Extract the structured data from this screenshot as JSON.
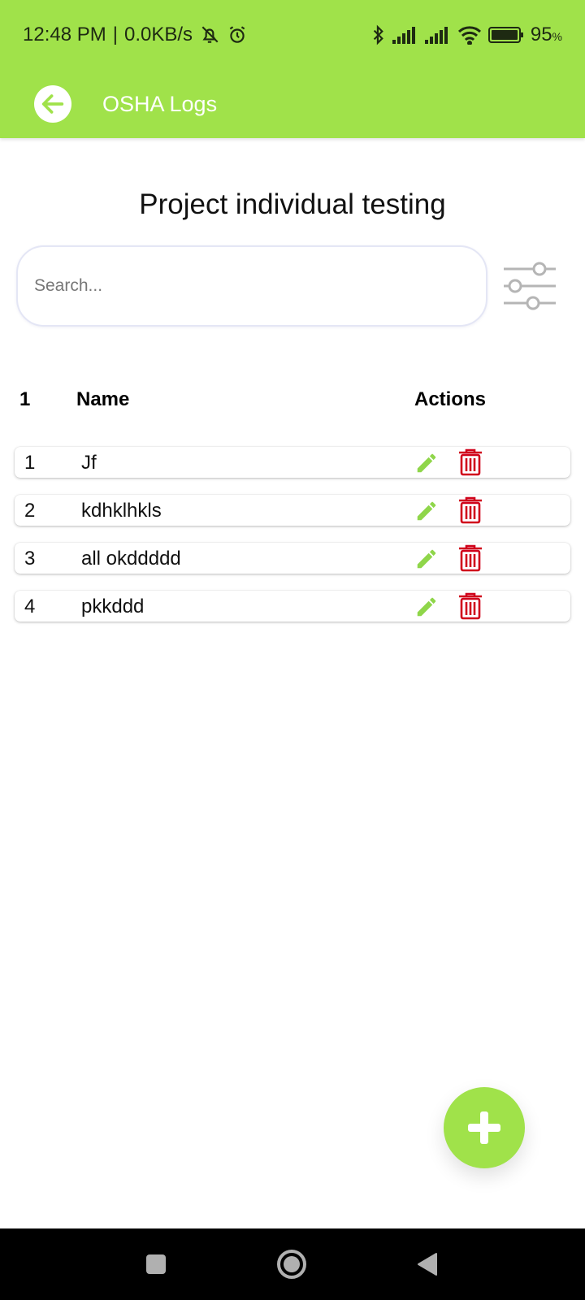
{
  "status_bar": {
    "time": "12:48 PM",
    "net_speed": "0.0KB/s",
    "battery_percent": "95",
    "battery_unit": "%",
    "icons": [
      "mute-notifications-icon",
      "alarm-icon",
      "bluetooth-icon",
      "signal-icon",
      "signal-icon",
      "wifi-icon",
      "battery-icon"
    ]
  },
  "app_bar": {
    "title": "OSHA Logs",
    "back_icon": "arrow-left-icon"
  },
  "page": {
    "title": "Project individual testing"
  },
  "search": {
    "placeholder": "Search...",
    "value": ""
  },
  "filter": {
    "icon": "sliders-icon"
  },
  "table": {
    "headers": {
      "num": "1",
      "name": "Name",
      "actions": "Actions"
    },
    "rows": [
      {
        "num": "1",
        "name": "Jf"
      },
      {
        "num": "2",
        "name": "kdhklhkls"
      },
      {
        "num": "3",
        "name": "all okddddd"
      },
      {
        "num": "4",
        "name": "pkkddd"
      }
    ]
  },
  "fab": {
    "icon": "plus-icon"
  },
  "nav": {
    "icons": [
      "recents-icon",
      "home-icon",
      "back-icon"
    ]
  },
  "colors": {
    "accent": "#a0e24a",
    "delete": "#d0021b",
    "nav_bg": "#000000"
  }
}
